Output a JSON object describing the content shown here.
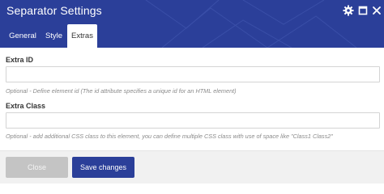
{
  "dialog": {
    "title": "Separator Settings",
    "tabs": [
      {
        "label": "General",
        "active": false
      },
      {
        "label": "Style",
        "active": false
      },
      {
        "label": "Extras",
        "active": true
      }
    ]
  },
  "fields": {
    "extra_id": {
      "label": "Extra ID",
      "value": "",
      "help": "Optional - Define element id (The id attribute specifies a unique id for an HTML element)"
    },
    "extra_class": {
      "label": "Extra Class",
      "value": "",
      "help": "Optional - add additional CSS class to this element, you can define multiple CSS class with use of space like \"Class1 Class2\""
    }
  },
  "footer": {
    "close_label": "Close",
    "save_label": "Save changes"
  },
  "icons": {
    "settings": "gear-icon",
    "fullscreen": "expand-icon",
    "close": "close-icon"
  },
  "colors": {
    "header": "#2b3f99",
    "primary_button": "#2b3f99",
    "close_button": "#c4c4c4",
    "footer": "#f1f1f1"
  }
}
